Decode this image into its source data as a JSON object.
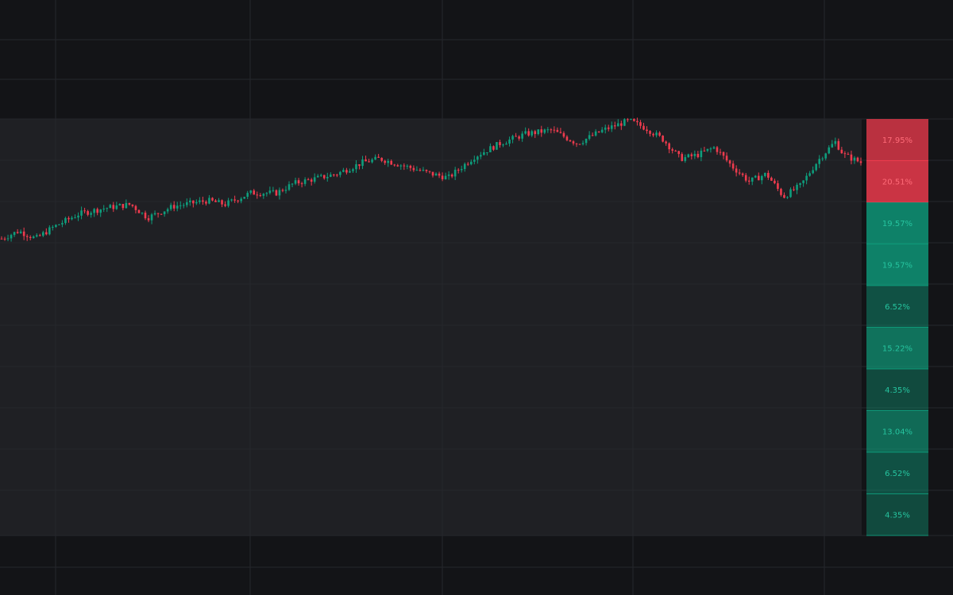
{
  "chart_data": {
    "type": "candlestick",
    "grid": true,
    "colors": {
      "background": "#131417",
      "panel": "#1f2024",
      "grid": "#26272c",
      "up": "#0e9d7c",
      "down": "#ef3b4e"
    },
    "price_range": [
      0,
      100
    ],
    "candles_anchors": [
      [
        0,
        38,
        1
      ],
      [
        0.02,
        42,
        0.5
      ],
      [
        0.04,
        38,
        -1.5
      ],
      [
        0.06,
        44,
        0.5
      ],
      [
        0.09,
        51,
        0.5
      ],
      [
        0.12,
        54,
        1
      ],
      [
        0.15,
        56,
        1
      ],
      [
        0.17,
        49,
        -2
      ],
      [
        0.2,
        55,
        0.7
      ],
      [
        0.24,
        58,
        0.8
      ],
      [
        0.26,
        56,
        -1
      ],
      [
        0.29,
        62,
        0.8
      ],
      [
        0.32,
        62,
        0.5
      ],
      [
        0.34,
        67,
        0.9
      ],
      [
        0.39,
        72,
        0.8
      ],
      [
        0.42,
        78,
        1
      ],
      [
        0.44,
        80,
        0.5
      ],
      [
        0.47,
        76,
        -1.5
      ],
      [
        0.5,
        72,
        -1
      ],
      [
        0.52,
        70,
        -1.2
      ],
      [
        0.55,
        81,
        1.5
      ],
      [
        0.58,
        88,
        1
      ],
      [
        0.61,
        93,
        1
      ],
      [
        0.64,
        95,
        0.8
      ],
      [
        0.67,
        88,
        -1.5
      ],
      [
        0.7,
        95,
        1
      ],
      [
        0.73,
        100,
        1
      ],
      [
        0.75,
        96,
        -1
      ],
      [
        0.77,
        90,
        -1.5
      ],
      [
        0.79,
        80,
        -2
      ],
      [
        0.81,
        82,
        1
      ],
      [
        0.83,
        86,
        1
      ],
      [
        0.85,
        76,
        -2.5
      ],
      [
        0.87,
        68,
        -2
      ],
      [
        0.89,
        72,
        1.2
      ],
      [
        0.91,
        60,
        -2
      ],
      [
        0.93,
        66,
        1.5
      ],
      [
        0.95,
        79,
        2
      ],
      [
        0.97,
        89,
        1.3
      ],
      [
        0.98,
        82,
        -1.5
      ],
      [
        1.0,
        78,
        -1
      ]
    ],
    "histogram": {
      "bins": [
        {
          "label": "17.95%",
          "value": 17.95,
          "direction": "down"
        },
        {
          "label": "20.51%",
          "value": 20.51,
          "direction": "down"
        },
        {
          "label": "19.57%",
          "value": 19.57,
          "direction": "up"
        },
        {
          "label": "19.57%",
          "value": 19.57,
          "direction": "up"
        },
        {
          "label": "6.52%",
          "value": 6.52,
          "direction": "up"
        },
        {
          "label": "15.22%",
          "value": 15.22,
          "direction": "up"
        },
        {
          "label": "4.35%",
          "value": 4.35,
          "direction": "up"
        },
        {
          "label": "13.04%",
          "value": 13.04,
          "direction": "up"
        },
        {
          "label": "6.52%",
          "value": 6.52,
          "direction": "up"
        },
        {
          "label": "4.35%",
          "value": 4.35,
          "direction": "up"
        }
      ]
    }
  }
}
